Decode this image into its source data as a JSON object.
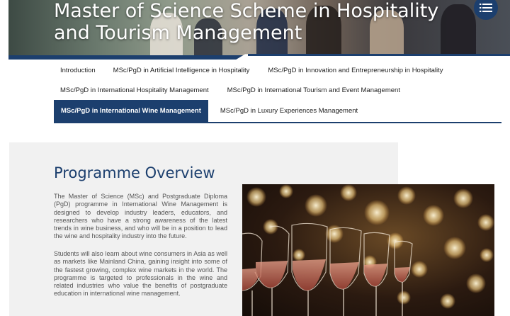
{
  "hero": {
    "title_line1": "Master of Science Scheme in Hospitality",
    "title_line2": "and Tourism Management"
  },
  "menu": {
    "icon": "list-menu-icon"
  },
  "tabs": {
    "row1": [
      "Introduction",
      "MSc/PgD in Artificial Intelligence in Hospitality",
      "MSc/PgD in Innovation and Entrepreneurship in Hospitality"
    ],
    "row2": [
      "MSc/PgD in International Hospitality Management",
      "MSc/PgD in International Tourism and Event Management"
    ],
    "row3": [
      "MSc/PgD in International Wine Management",
      "MSc/PgD in Luxury Experiences Management"
    ],
    "active": "MSc/PgD in International Wine Management"
  },
  "overview": {
    "heading": "Programme Overview",
    "paragraph1": "The Master of Science (MSc) and Postgraduate Diploma (PgD) programme in International Wine Management is designed to develop industry leaders, educators, and researchers who have a strong awareness of the latest trends in wine business, and who will be in a position to lead the wine and hospitality industry into the future.",
    "paragraph2": "Students will also learn about wine consumers in Asia as well as markets like Mainland China, gaining insight into some of the fastest growing, complex wine markets in the world. The programme is targeted to professionals in the wine and related industries who value the benefits of postgraduate education in international wine management."
  },
  "colors": {
    "brand_navy": "#1c3f6e",
    "panel_grey": "#f1f1f1"
  }
}
